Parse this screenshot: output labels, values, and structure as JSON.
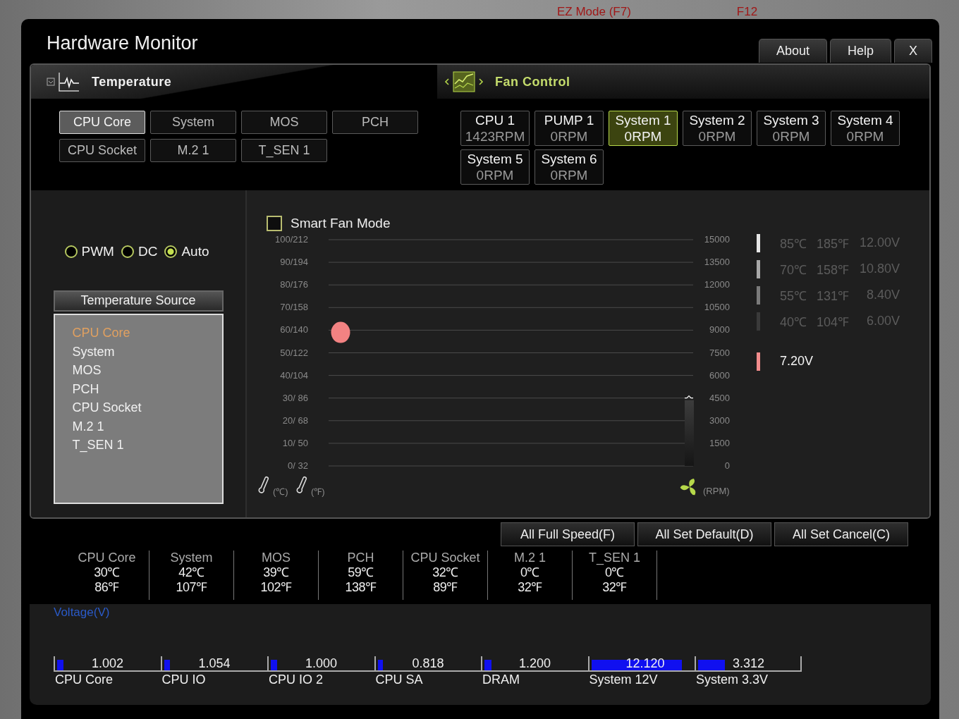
{
  "backdrop": {
    "labels": [
      "EZ Mode (F7)",
      "F12"
    ]
  },
  "window": {
    "title": "Hardware Monitor",
    "buttons": [
      "About",
      "Help",
      "X"
    ]
  },
  "temperature": {
    "title": "Temperature",
    "tabs": [
      {
        "label": "CPU Core",
        "selected": true
      },
      {
        "label": "System",
        "selected": false
      },
      {
        "label": "MOS",
        "selected": false
      },
      {
        "label": "PCH",
        "selected": false
      },
      {
        "label": "CPU Socket",
        "selected": false
      },
      {
        "label": "M.2 1",
        "selected": false
      },
      {
        "label": "T_SEN 1",
        "selected": false
      }
    ]
  },
  "fan_control": {
    "title": "Fan Control",
    "fans": [
      {
        "name": "CPU 1",
        "speed": "1423RPM",
        "selected": false
      },
      {
        "name": "PUMP 1",
        "speed": "0RPM",
        "selected": false
      },
      {
        "name": "System 1",
        "speed": "0RPM",
        "selected": true
      },
      {
        "name": "System 2",
        "speed": "0RPM",
        "selected": false
      },
      {
        "name": "System 3",
        "speed": "0RPM",
        "selected": false
      },
      {
        "name": "System 4",
        "speed": "0RPM",
        "selected": false
      },
      {
        "name": "System 5",
        "speed": "0RPM",
        "selected": false
      },
      {
        "name": "System 6",
        "speed": "0RPM",
        "selected": false
      }
    ]
  },
  "mode_options": [
    {
      "label": "PWM",
      "selected": false
    },
    {
      "label": "DC",
      "selected": false
    },
    {
      "label": "Auto",
      "selected": true
    }
  ],
  "temperature_source": {
    "title": "Temperature Source",
    "items": [
      {
        "label": "CPU Core",
        "selected": true
      },
      {
        "label": "System",
        "selected": false
      },
      {
        "label": "MOS",
        "selected": false
      },
      {
        "label": "PCH",
        "selected": false
      },
      {
        "label": "CPU Socket",
        "selected": false
      },
      {
        "label": "M.2 1",
        "selected": false
      },
      {
        "label": "T_SEN 1",
        "selected": false
      }
    ]
  },
  "smart_fan_mode": {
    "label": "Smart Fan Mode",
    "checked": false
  },
  "fan_chart": {
    "temp_ticks": [
      "100/212",
      "90/194",
      "80/176",
      "70/158",
      "60/140",
      "50/122",
      "40/104",
      "30/  86",
      "20/  68",
      "10/  50",
      "0/  32"
    ],
    "rpm_ticks": [
      "15000",
      "13500",
      "12000",
      "10500",
      "9000",
      "7500",
      "6000",
      "4500",
      "3000",
      "1500",
      "0"
    ],
    "celsius_unit": "(℃)",
    "fahrenheit_unit": "(℉)",
    "rpm_unit": "(RPM)"
  },
  "voltage_legend": [
    {
      "celsius": "85℃",
      "fahrenheit": "185℉",
      "volts": "12.00V",
      "color": "#e6e6e6"
    },
    {
      "celsius": "70℃",
      "fahrenheit": "158℉",
      "volts": "10.80V",
      "color": "#a8a8a8"
    },
    {
      "celsius": "55℃",
      "fahrenheit": "131℉",
      "volts": "8.40V",
      "color": "#7a7a7a"
    },
    {
      "celsius": "40℃",
      "fahrenheit": "104℉",
      "volts": "6.00V",
      "color": "#3a3a3a"
    }
  ],
  "current_voltage": {
    "volts": "7.20V",
    "color": "#f28c8c"
  },
  "actions": [
    "All Full Speed(F)",
    "All Set Default(D)",
    "All Set Cancel(C)"
  ],
  "readings": [
    {
      "name": "CPU Core",
      "celsius": "30℃",
      "fahrenheit": "86℉"
    },
    {
      "name": "System",
      "celsius": "42℃",
      "fahrenheit": "107℉"
    },
    {
      "name": "MOS",
      "celsius": "39℃",
      "fahrenheit": "102℉"
    },
    {
      "name": "PCH",
      "celsius": "59℃",
      "fahrenheit": "138℉"
    },
    {
      "name": "CPU Socket",
      "celsius": "32℃",
      "fahrenheit": "89℉"
    },
    {
      "name": "M.2 1",
      "celsius": "0℃",
      "fahrenheit": "32℉"
    },
    {
      "name": "T_SEN 1",
      "celsius": "0℃",
      "fahrenheit": "32℉"
    }
  ],
  "voltage": {
    "title": "Voltage(V)",
    "items": [
      {
        "name": "CPU Core",
        "value": "1.002",
        "level": 0.06
      },
      {
        "name": "CPU IO",
        "value": "1.054",
        "level": 0.06
      },
      {
        "name": "CPU IO 2",
        "value": "1.000",
        "level": 0.06
      },
      {
        "name": "CPU SA",
        "value": "0.818",
        "level": 0.05
      },
      {
        "name": "DRAM",
        "value": "1.200",
        "level": 0.07
      },
      {
        "name": "System 12V",
        "value": "12.120",
        "level": 0.88
      },
      {
        "name": "System 3.3V",
        "value": "3.312",
        "level": 0.26
      }
    ]
  }
}
